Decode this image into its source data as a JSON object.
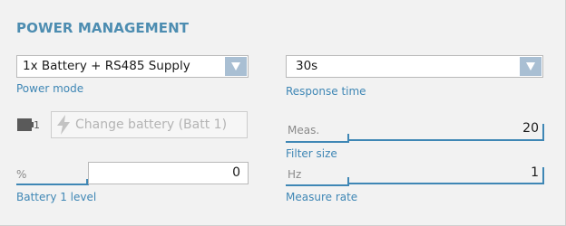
{
  "section": {
    "title": "POWER MANAGEMENT"
  },
  "power_mode": {
    "value": "1x Battery + RS485 Supply",
    "caption": "Power mode"
  },
  "response_time": {
    "value": "30s",
    "caption": "Response time"
  },
  "battery": {
    "icon": "battery-icon",
    "index": "1",
    "change_button_label": "Change battery (Batt 1)",
    "change_button_icon": "lightning-bolt-icon",
    "level_unit": "%",
    "level_value": "0",
    "level_caption": "Battery 1 level"
  },
  "filter_size": {
    "unit": "Meas.",
    "value": "20",
    "caption": "Filter size"
  },
  "measure_rate": {
    "unit": "Hz",
    "value": "1",
    "caption": "Measure rate"
  },
  "colors": {
    "accent": "#3f87b5",
    "title": "#4d8db1",
    "dropdown_button": "#a9bfd3",
    "panel_bg": "#f2f2f2",
    "bracket": "#3f87b5"
  }
}
